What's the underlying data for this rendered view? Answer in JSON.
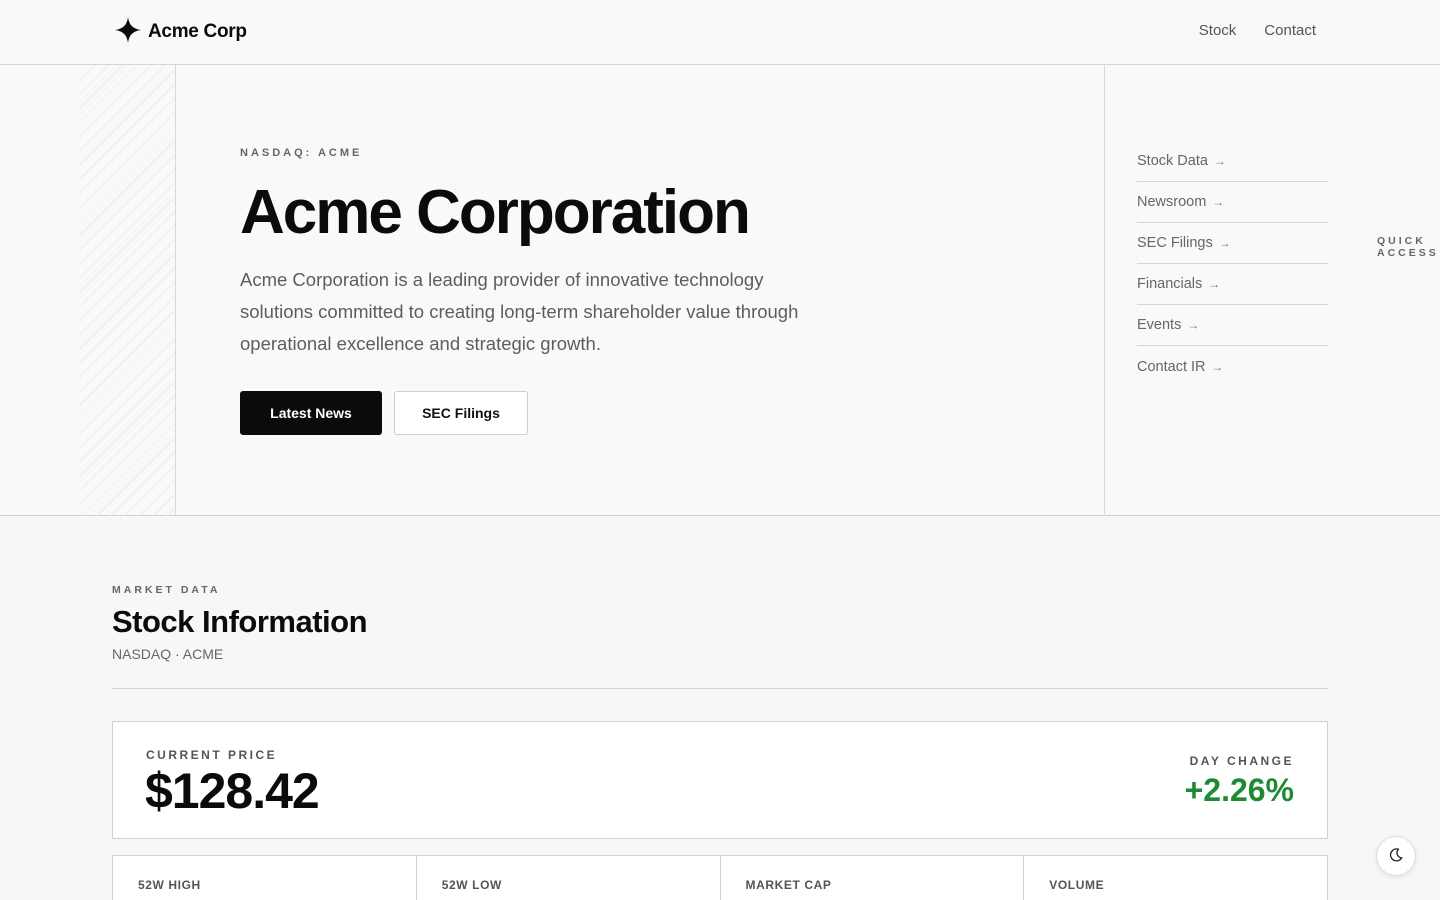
{
  "header": {
    "brand": "Acme Corp",
    "nav": [
      {
        "label": "Stock"
      },
      {
        "label": "Contact"
      }
    ]
  },
  "hero": {
    "eyebrow": "NASDAQ: ACME",
    "title": "Acme Corporation",
    "description": "Acme Corporation is a leading provider of innovative technology solutions committed to creating long-term shareholder value through operational excellence and strategic growth.",
    "primary_button": "Latest News",
    "secondary_button": "SEC Filings"
  },
  "quick_access": {
    "heading": "QUICK ACCESS",
    "items": [
      {
        "label": "Stock Data"
      },
      {
        "label": "Newsroom"
      },
      {
        "label": "SEC Filings"
      },
      {
        "label": "Financials"
      },
      {
        "label": "Events"
      },
      {
        "label": "Contact IR"
      }
    ],
    "arrow": "→"
  },
  "market": {
    "eyebrow": "MARKET DATA",
    "title": "Stock Information",
    "subtitle": "NASDAQ · ACME",
    "current_price_label": "CURRENT PRICE",
    "current_price": "$128.42",
    "day_change_label": "DAY CHANGE",
    "day_change": "+2.26%",
    "stats": [
      {
        "label": "52W HIGH"
      },
      {
        "label": "52W LOW"
      },
      {
        "label": "MARKET CAP"
      },
      {
        "label": "VOLUME"
      }
    ]
  },
  "colors": {
    "accent": "#0b0b0b",
    "positive": "#1f8a34",
    "background": "#f7f7f7"
  },
  "icons": {
    "brand": "sparkle-icon",
    "theme_toggle": "moon-icon"
  }
}
